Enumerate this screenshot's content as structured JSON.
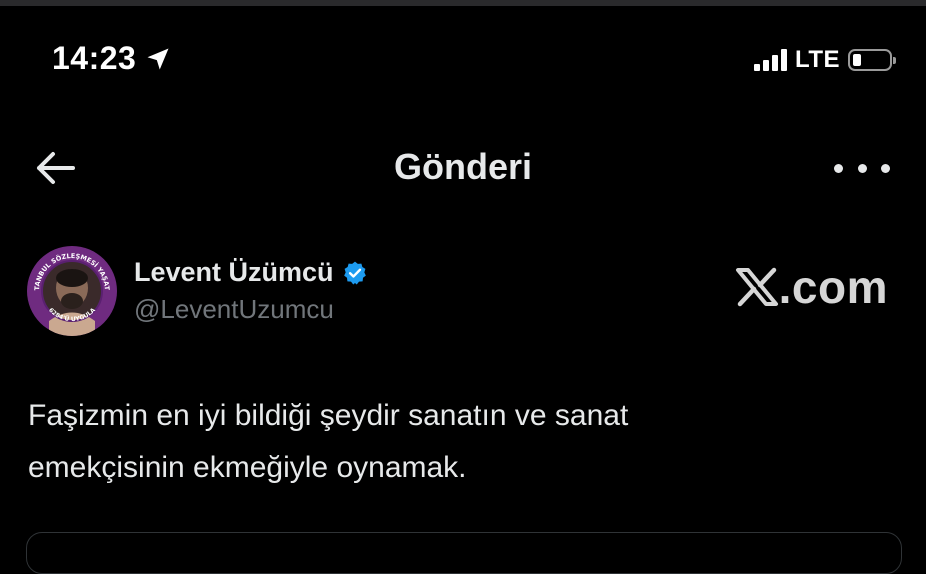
{
  "status_bar": {
    "time": "14:23",
    "network": "LTE",
    "battery_level": 0.2,
    "signal_bars": 4
  },
  "header": {
    "title": "Gönderi"
  },
  "tweet": {
    "author_name": "Levent Üzümcü",
    "author_handle": "@LeventUzumcu",
    "verified": true,
    "avatar_ring_text": "İSTANBUL SÖZLEŞMESİ YAŞATIR",
    "avatar_bottom_text": "6284'Ü UYGULA",
    "text_line_1": "Faşizmin en iyi bildiği şeydir sanatın ve sanat",
    "text_line_2": "emekçisinin ekmeğiyle oynamak."
  },
  "watermark": {
    "logo_glyph": "X",
    "suffix": ".com"
  },
  "colors": {
    "background": "#000000",
    "text_primary": "#e7e9ea",
    "text_secondary": "#71767b",
    "verified_blue": "#1d9bf0",
    "avatar_purple": "#6f2b80"
  },
  "icons": {
    "location": "location-arrow-icon",
    "back": "arrow-left-icon",
    "more": "more-horizontal-icon",
    "verified": "verified-badge-icon"
  }
}
